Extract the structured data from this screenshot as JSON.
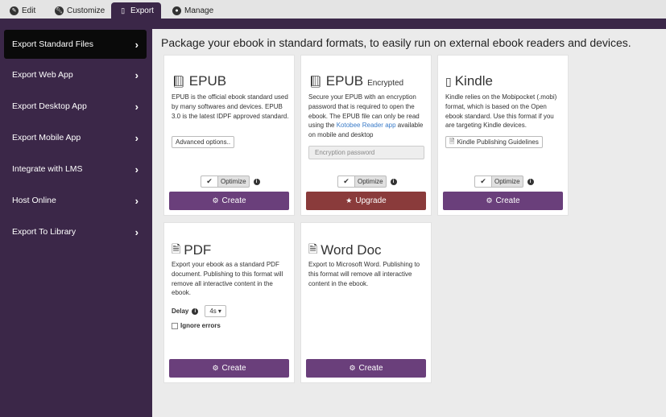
{
  "tabs": [
    {
      "label": "Edit",
      "icon": "edit-icon"
    },
    {
      "label": "Customize",
      "icon": "wrench-icon"
    },
    {
      "label": "Export",
      "icon": "mobile-icon",
      "active": true
    },
    {
      "label": "Manage",
      "icon": "user-icon"
    }
  ],
  "sidebar": {
    "items": [
      {
        "label": "Export Standard Files",
        "active": true
      },
      {
        "label": "Export Web App"
      },
      {
        "label": "Export Desktop App"
      },
      {
        "label": "Export Mobile App"
      },
      {
        "label": "Integrate with LMS"
      },
      {
        "label": "Host Online"
      },
      {
        "label": "Export To Library"
      }
    ]
  },
  "headline": "Package your ebook in standard formats, to easily run on external ebook readers and devices.",
  "cards": {
    "epub": {
      "title": "EPUB",
      "icon": "book-icon",
      "desc": "EPUB is the official ebook standard used by many softwares and devices. EPUB 3.0 is the latest IDPF approved standard.",
      "options_label": "Advanced options..",
      "optimize_label": "Optimize",
      "button_label": "Create"
    },
    "epub_encrypted": {
      "title": "EPUB",
      "subtitle": "Encrypted",
      "icon": "book-icon",
      "desc_pre": "Secure your EPUB with an encryption password that is required to open the ebook. The EPUB file can only be read using the ",
      "desc_link": "Kotobee Reader app",
      "desc_post": " available on mobile and desktop",
      "password_placeholder": "Encryption password",
      "optimize_label": "Optimize",
      "button_label": "Upgrade"
    },
    "kindle": {
      "title": "Kindle",
      "icon": "tablet-icon",
      "desc": "Kindle relies on the Mobipocket (.mobi) format, which is based on the Open ebook standard. Use this format if you are targeting Kindle devices.",
      "guide_label": "Kindle Publishing Guidelines",
      "optimize_label": "Optimize",
      "button_label": "Create"
    },
    "pdf": {
      "title": "PDF",
      "icon": "pdf-file-icon",
      "desc": "Export your ebook as a standard PDF document. Publishing to this format will remove all interactive content in the ebook.",
      "delay_label": "Delay",
      "delay_value": "4s",
      "ignore_label": "Ignore errors",
      "button_label": "Create"
    },
    "word": {
      "title": "Word Doc",
      "icon": "word-file-icon",
      "desc": "Export to Microsoft Word. Publishing to this format will remove all interactive content in the ebook.",
      "button_label": "Create"
    }
  },
  "colors": {
    "sidebar_bg": "#3b2748",
    "create_button": "#6a3f7b",
    "upgrade_button": "#8a3b3b",
    "active_item": "#0a0a0a"
  }
}
